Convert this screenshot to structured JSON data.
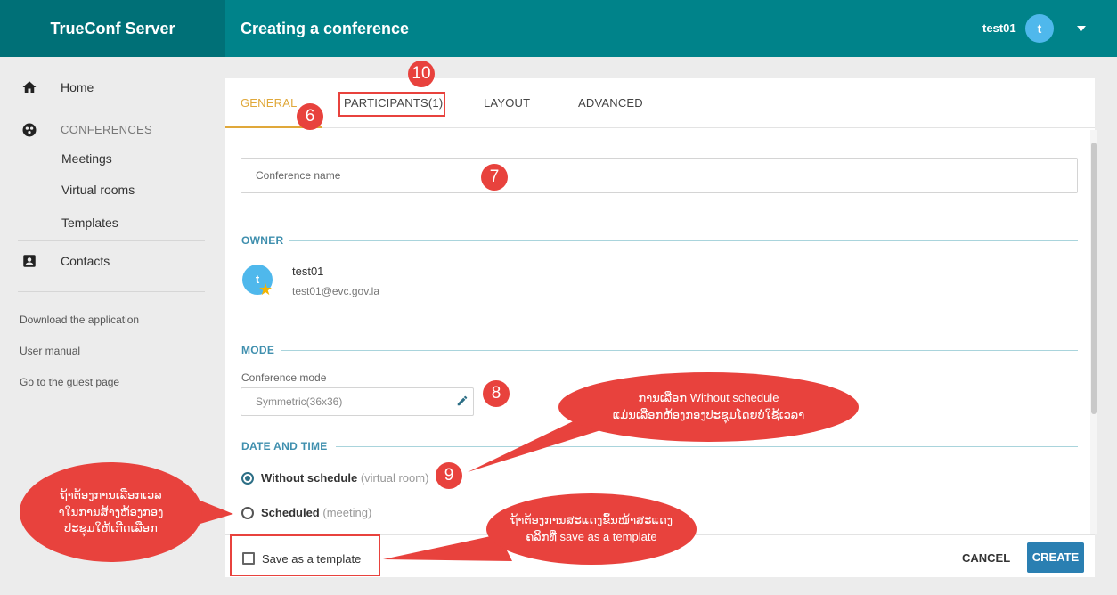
{
  "app": {
    "brand": "TrueConf Server",
    "page_title": "Creating a conference"
  },
  "user": {
    "name": "test01",
    "avatar_letter": "t"
  },
  "sidebar": {
    "home": "Home",
    "conferences": "CONFERENCES",
    "meetings": "Meetings",
    "virtual_rooms": "Virtual rooms",
    "templates": "Templates",
    "contacts": "Contacts",
    "links": [
      "Download the application",
      "User manual",
      "Go to the guest page"
    ]
  },
  "tabs": [
    {
      "label": "GENERAL"
    },
    {
      "label": "PARTICIPANTS(1)"
    },
    {
      "label": "LAYOUT"
    },
    {
      "label": "ADVANCED"
    }
  ],
  "form": {
    "conference_name_placeholder": "Conference name",
    "owner_heading": "OWNER",
    "owner_name": "test01",
    "owner_email": "test01@evc.gov.la",
    "owner_avatar_letter": "t",
    "mode_heading": "MODE",
    "mode_label": "Conference mode",
    "mode_value": "Symmetric(36x36)",
    "datetime_heading": "DATE AND TIME",
    "option_without_schedule": "Without schedule",
    "option_without_schedule_hint": "(virtual room)",
    "option_scheduled": "Scheduled",
    "option_scheduled_hint": "(meeting)",
    "save_template": "Save as a template"
  },
  "actions": {
    "cancel": "CANCEL",
    "create": "CREATE"
  },
  "annotations": {
    "badges": [
      "10",
      "6",
      "7",
      "8",
      "9"
    ],
    "bubble_mode": [
      "ການເລືອກ Without schedule",
      "ແມ່ນເລືອກຫ້ອງກອງປະຊຸມໂດຍບໍ່ໃຊ້ເວລາ"
    ],
    "bubble_schedule": [
      "ຖ້າຕ້ອງການເລືອກເວລ",
      "າໃນການສ້າງຫ້ອງກອງ",
      "ປະຊຸມໃຫ້ເກີດເລືອກ"
    ],
    "bubble_template": [
      "ຖ້າຕ້ອງການສະແດງຂຶ້ນໜ້າສະແດງ",
      "ຄລິກທີ່ save as a template"
    ]
  },
  "colors": {
    "topbar": "#00838a",
    "accent_tab": "#e0a83a",
    "annotation": "#e8423d",
    "create_button": "#2a7fb2"
  }
}
